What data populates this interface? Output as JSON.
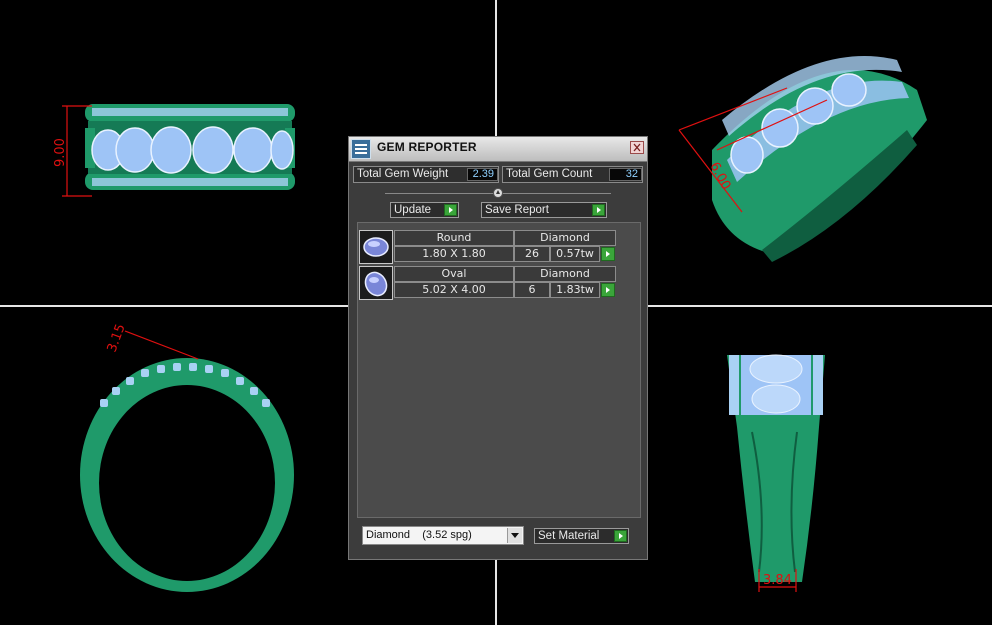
{
  "window": {
    "title": "GEM REPORTER"
  },
  "summary": {
    "weight_label": "Total Gem Weight",
    "weight_value": "2.39",
    "count_label": "Total Gem Count",
    "count_value": "32"
  },
  "buttons": {
    "update": "Update",
    "save_report": "Save Report",
    "set_material": "Set Material"
  },
  "gems": [
    {
      "shape": "Round",
      "size": "1.80 X 1.80",
      "material": "Diamond",
      "count": "26",
      "weight": "0.57tw"
    },
    {
      "shape": "Oval",
      "size": "5.02 X 4.00",
      "material": "Diamond",
      "count": "6",
      "weight": "1.83tw"
    }
  ],
  "material_select": {
    "value": "Diamond    (3.52 spg)"
  },
  "dimensions": {
    "front_height": "9.00",
    "top_right": "6.00",
    "side_width": "3.15",
    "bottom_right": "3.84"
  },
  "colors": {
    "metal": "#1f9a6a",
    "gem": "#9ec4f6",
    "dimension": "#e01010",
    "background": "#000000"
  },
  "icons": [
    "gem-reporter-icon",
    "close-icon",
    "slider-knob",
    "play-icon",
    "round-gem-icon",
    "oval-gem-icon",
    "dropdown-arrow-icon"
  ]
}
